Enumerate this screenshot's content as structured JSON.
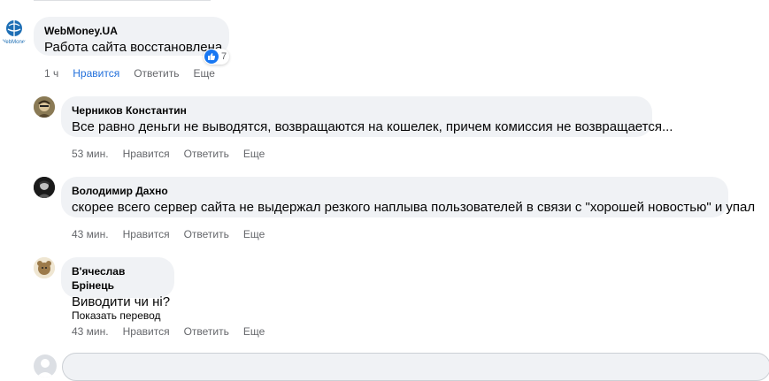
{
  "comments": [
    {
      "author": "WebMoney.UA",
      "text": "Работа сайта восстановлена.",
      "time": "1 ч",
      "like": "Нравится",
      "reply": "Ответить",
      "more": "Еще",
      "reactions": "7",
      "avatar_text": "WebMoney"
    },
    {
      "author": "Черников Константин",
      "text": "Все равно деньги не выводятся, возвращаются на кошелек, причем комиссия не возвращается...",
      "time": "53 мин.",
      "like": "Нравится",
      "reply": "Ответить",
      "more": "Еще"
    },
    {
      "author": "Володимир Дахно",
      "text": "скорее всего сервер сайта не выдержал резкого наплыва пользователей в связи с \"хорошей новостью\" и упал",
      "time": "43 мин.",
      "like": "Нравится",
      "reply": "Ответить",
      "more": "Еще"
    },
    {
      "author": "В'ячеслав Брінець",
      "text": "Виводити чи ні?",
      "time": "43 мин.",
      "like": "Нравится",
      "reply": "Ответить",
      "more": "Еще",
      "translate": "Показать перевод"
    }
  ],
  "colors": {
    "bubble": "#f0f2f5",
    "meta": "#65676b",
    "like_active": "#216fdb",
    "reaction_blue": "#1877f2"
  }
}
